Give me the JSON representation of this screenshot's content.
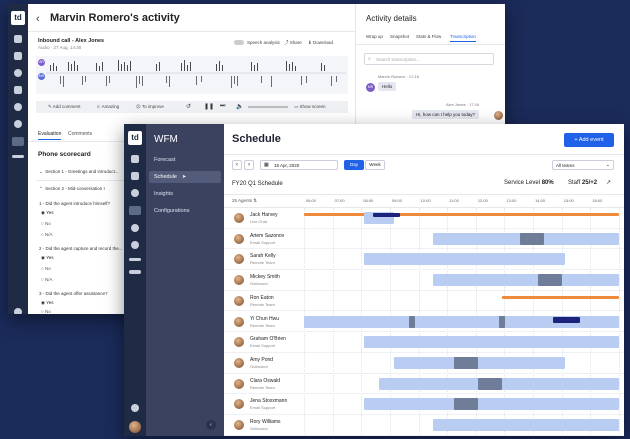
{
  "activity": {
    "title": "Marvin Romero's activity",
    "call_title": "Inbound call - Alex Jones",
    "call_meta": "Audio · 27 Aug, 14:30",
    "speech_analysis": "Speech analysis",
    "share": "Share",
    "download": "Download",
    "track_badges": [
      "AR",
      "MR"
    ],
    "controls": [
      "Add comment",
      "Amazing",
      "To improve",
      "Show screen"
    ],
    "tabs": [
      "Evaluation",
      "Comments"
    ],
    "scorecard_title": "Phone scorecard",
    "section1": "Section 1 - Greetings and introduct...",
    "section2": "Section 2 - Mid-conversation I",
    "questions": [
      {
        "label": "1 - Did the agent introduce himself?",
        "options": [
          "Yes",
          "No",
          "N/A"
        ],
        "selected": 0
      },
      {
        "label": "2 - Did the agent capture and record the...",
        "options": [
          "Yes",
          "No",
          "N/A"
        ],
        "selected": 0
      },
      {
        "label": "3 - Did the agent offer assistance?",
        "options": [
          "Yes",
          "No"
        ],
        "selected": 0
      }
    ]
  },
  "details": {
    "title": "Activity details",
    "tabs": [
      "Wrap up",
      "Snapshot",
      "Stats & Flow",
      "Transcription"
    ],
    "active_tab": 3,
    "search_placeholder": "Search transcription...",
    "messages": [
      {
        "from": "Marvin Romero",
        "time": "17:16",
        "text": "Hello",
        "side": "left"
      },
      {
        "from": "Alex Jones",
        "time": "17:16",
        "text": "Hi, how can I help you today?",
        "side": "right"
      }
    ]
  },
  "wfm": {
    "title": "WFM",
    "nav": [
      "Forecast",
      "Schedule",
      "Insights",
      "Configurations"
    ],
    "active_nav": 1
  },
  "schedule": {
    "title": "Schedule",
    "add_event": "+ Add event",
    "date": "16 Apr, 2020",
    "view_day": "Day",
    "view_week": "Week",
    "team_filter": "All teams",
    "plan_title": "FY20 Q1 Schedule",
    "service_level_label": "Service Level",
    "service_level": "80%",
    "staff_label": "Staff",
    "staff_value": "25/+2",
    "agents_header": "25 Agents",
    "hours": [
      "06:00",
      "07:00",
      "08:00",
      "09:00",
      "10:00",
      "11:00",
      "12:00",
      "13:00",
      "14:00",
      "15:00",
      "16:00"
    ],
    "agents": [
      {
        "name": "Jack Harvey",
        "team": "Live Chat",
        "shifts": [
          [
            0,
            10.5,
            "orange"
          ],
          [
            2,
            3,
            "light"
          ],
          [
            2.3,
            3.2,
            "navy"
          ]
        ]
      },
      {
        "name": "Artem Sazonov",
        "team": "Email Support",
        "shifts": [
          [
            4.3,
            10.5,
            "light"
          ],
          [
            7.2,
            8,
            "mid"
          ]
        ]
      },
      {
        "name": "Sarah Kelly",
        "team": "Remote Team",
        "shifts": [
          [
            2,
            8.7,
            "light"
          ]
        ]
      },
      {
        "name": "Mickey Smith",
        "team": "Outbound",
        "shifts": [
          [
            4.3,
            10.5,
            "light"
          ],
          [
            7.8,
            8.6,
            "mid"
          ]
        ]
      },
      {
        "name": "Ron Eaton",
        "team": "Remote Team",
        "shifts": [
          [
            6.6,
            10.5,
            "orange"
          ]
        ]
      },
      {
        "name": "Yi Chun Hwu",
        "team": "Remote Team",
        "shifts": [
          [
            0,
            10.5,
            "light"
          ],
          [
            3.5,
            3.7,
            "mid"
          ],
          [
            6.5,
            6.7,
            "mid"
          ],
          [
            8.3,
            9.2,
            "navy"
          ]
        ]
      },
      {
        "name": "Graham O'Brien",
        "team": "Email Support",
        "shifts": [
          [
            2,
            10.5,
            "light"
          ]
        ]
      },
      {
        "name": "Amy Pond",
        "team": "Outbound",
        "shifts": [
          [
            3,
            8.7,
            "light"
          ],
          [
            5,
            5.8,
            "mid"
          ]
        ]
      },
      {
        "name": "Clara Oswald",
        "team": "Remote Team",
        "shifts": [
          [
            2.5,
            10.5,
            "light"
          ],
          [
            5.8,
            6.6,
            "mid"
          ]
        ]
      },
      {
        "name": "Jena Stoxxmann",
        "team": "Email Support",
        "shifts": [
          [
            2,
            10.5,
            "light"
          ],
          [
            5,
            5.8,
            "mid"
          ]
        ]
      },
      {
        "name": "Rory Williams",
        "team": "Outbound",
        "shifts": [
          [
            4.3,
            10.5,
            "light"
          ]
        ]
      }
    ]
  },
  "colors": {
    "rail": "#1f2a44",
    "wfm_sidebar": "#3a4260",
    "primary": "#1f62e8",
    "light": "#b9cdf3",
    "mid": "#6f7d99",
    "navy": "#1d237a",
    "orange": "#ef8a3a"
  }
}
